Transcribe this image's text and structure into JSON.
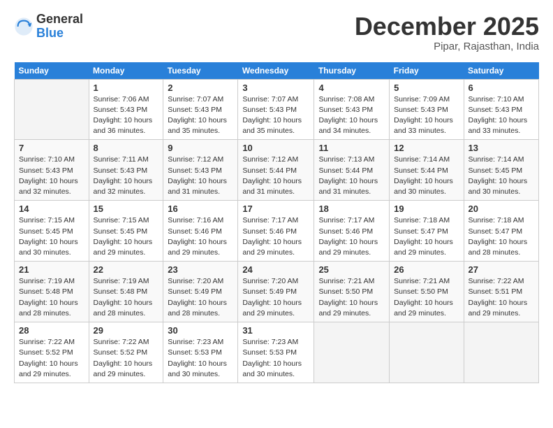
{
  "logo": {
    "general": "General",
    "blue": "Blue"
  },
  "header": {
    "month": "December 2025",
    "location": "Pipar, Rajasthan, India"
  },
  "days_of_week": [
    "Sunday",
    "Monday",
    "Tuesday",
    "Wednesday",
    "Thursday",
    "Friday",
    "Saturday"
  ],
  "weeks": [
    [
      {
        "day": "",
        "content": ""
      },
      {
        "day": "1",
        "content": "Sunrise: 7:06 AM\nSunset: 5:43 PM\nDaylight: 10 hours\nand 36 minutes."
      },
      {
        "day": "2",
        "content": "Sunrise: 7:07 AM\nSunset: 5:43 PM\nDaylight: 10 hours\nand 35 minutes."
      },
      {
        "day": "3",
        "content": "Sunrise: 7:07 AM\nSunset: 5:43 PM\nDaylight: 10 hours\nand 35 minutes."
      },
      {
        "day": "4",
        "content": "Sunrise: 7:08 AM\nSunset: 5:43 PM\nDaylight: 10 hours\nand 34 minutes."
      },
      {
        "day": "5",
        "content": "Sunrise: 7:09 AM\nSunset: 5:43 PM\nDaylight: 10 hours\nand 33 minutes."
      },
      {
        "day": "6",
        "content": "Sunrise: 7:10 AM\nSunset: 5:43 PM\nDaylight: 10 hours\nand 33 minutes."
      }
    ],
    [
      {
        "day": "7",
        "content": "Sunrise: 7:10 AM\nSunset: 5:43 PM\nDaylight: 10 hours\nand 32 minutes."
      },
      {
        "day": "8",
        "content": "Sunrise: 7:11 AM\nSunset: 5:43 PM\nDaylight: 10 hours\nand 32 minutes."
      },
      {
        "day": "9",
        "content": "Sunrise: 7:12 AM\nSunset: 5:43 PM\nDaylight: 10 hours\nand 31 minutes."
      },
      {
        "day": "10",
        "content": "Sunrise: 7:12 AM\nSunset: 5:44 PM\nDaylight: 10 hours\nand 31 minutes."
      },
      {
        "day": "11",
        "content": "Sunrise: 7:13 AM\nSunset: 5:44 PM\nDaylight: 10 hours\nand 31 minutes."
      },
      {
        "day": "12",
        "content": "Sunrise: 7:14 AM\nSunset: 5:44 PM\nDaylight: 10 hours\nand 30 minutes."
      },
      {
        "day": "13",
        "content": "Sunrise: 7:14 AM\nSunset: 5:45 PM\nDaylight: 10 hours\nand 30 minutes."
      }
    ],
    [
      {
        "day": "14",
        "content": "Sunrise: 7:15 AM\nSunset: 5:45 PM\nDaylight: 10 hours\nand 30 minutes."
      },
      {
        "day": "15",
        "content": "Sunrise: 7:15 AM\nSunset: 5:45 PM\nDaylight: 10 hours\nand 29 minutes."
      },
      {
        "day": "16",
        "content": "Sunrise: 7:16 AM\nSunset: 5:46 PM\nDaylight: 10 hours\nand 29 minutes."
      },
      {
        "day": "17",
        "content": "Sunrise: 7:17 AM\nSunset: 5:46 PM\nDaylight: 10 hours\nand 29 minutes."
      },
      {
        "day": "18",
        "content": "Sunrise: 7:17 AM\nSunset: 5:46 PM\nDaylight: 10 hours\nand 29 minutes."
      },
      {
        "day": "19",
        "content": "Sunrise: 7:18 AM\nSunset: 5:47 PM\nDaylight: 10 hours\nand 29 minutes."
      },
      {
        "day": "20",
        "content": "Sunrise: 7:18 AM\nSunset: 5:47 PM\nDaylight: 10 hours\nand 28 minutes."
      }
    ],
    [
      {
        "day": "21",
        "content": "Sunrise: 7:19 AM\nSunset: 5:48 PM\nDaylight: 10 hours\nand 28 minutes."
      },
      {
        "day": "22",
        "content": "Sunrise: 7:19 AM\nSunset: 5:48 PM\nDaylight: 10 hours\nand 28 minutes."
      },
      {
        "day": "23",
        "content": "Sunrise: 7:20 AM\nSunset: 5:49 PM\nDaylight: 10 hours\nand 28 minutes."
      },
      {
        "day": "24",
        "content": "Sunrise: 7:20 AM\nSunset: 5:49 PM\nDaylight: 10 hours\nand 29 minutes."
      },
      {
        "day": "25",
        "content": "Sunrise: 7:21 AM\nSunset: 5:50 PM\nDaylight: 10 hours\nand 29 minutes."
      },
      {
        "day": "26",
        "content": "Sunrise: 7:21 AM\nSunset: 5:50 PM\nDaylight: 10 hours\nand 29 minutes."
      },
      {
        "day": "27",
        "content": "Sunrise: 7:22 AM\nSunset: 5:51 PM\nDaylight: 10 hours\nand 29 minutes."
      }
    ],
    [
      {
        "day": "28",
        "content": "Sunrise: 7:22 AM\nSunset: 5:52 PM\nDaylight: 10 hours\nand 29 minutes."
      },
      {
        "day": "29",
        "content": "Sunrise: 7:22 AM\nSunset: 5:52 PM\nDaylight: 10 hours\nand 29 minutes."
      },
      {
        "day": "30",
        "content": "Sunrise: 7:23 AM\nSunset: 5:53 PM\nDaylight: 10 hours\nand 30 minutes."
      },
      {
        "day": "31",
        "content": "Sunrise: 7:23 AM\nSunset: 5:53 PM\nDaylight: 10 hours\nand 30 minutes."
      },
      {
        "day": "",
        "content": ""
      },
      {
        "day": "",
        "content": ""
      },
      {
        "day": "",
        "content": ""
      }
    ]
  ]
}
